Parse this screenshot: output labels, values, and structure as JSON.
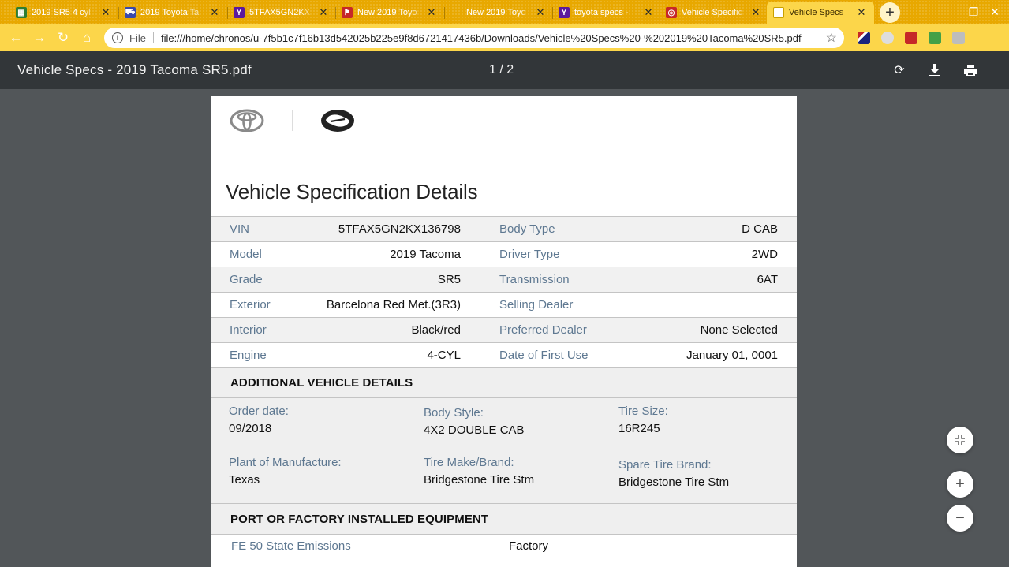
{
  "browser": {
    "tabs": [
      {
        "title": "2019 SR5 4 cyl",
        "favicon_color": "#2e7d32",
        "favicon_glyph": "▦",
        "icon": "image-favicon"
      },
      {
        "title": "2019 Toyota Ta",
        "favicon_color": "#3949ab",
        "favicon_glyph": "🚗",
        "icon": "car-favicon"
      },
      {
        "title": "5TFAX5GN2KX",
        "favicon_color": "#5c1a9e",
        "favicon_glyph": "Y",
        "icon": "yahoo-favicon"
      },
      {
        "title": "New 2019 Toyo",
        "favicon_color": "#c62828",
        "favicon_glyph": "⚑",
        "icon": "dealer-favicon"
      },
      {
        "title": "New 2019 Toyo",
        "favicon_color": "",
        "favicon_glyph": "",
        "icon": "blank-favicon"
      },
      {
        "title": "toyota specs -",
        "favicon_color": "#5c1a9e",
        "favicon_glyph": "Y",
        "icon": "yahoo-favicon"
      },
      {
        "title": "Vehicle Specific",
        "favicon_color": "#c62828",
        "favicon_glyph": "T",
        "icon": "toyota-favicon"
      },
      {
        "title": "Vehicle Specs",
        "favicon_color": "#ffffff",
        "favicon_glyph": "",
        "icon": "document-favicon"
      }
    ],
    "active_tab_index": 7,
    "url_scheme": "File",
    "url": "file:///home/chronos/u-7f5b1c7f16b13d542025b225e9f8d6721417436b/Downloads/Vehicle%20Specs%20-%202019%20Tacoma%20SR5.pdf",
    "theme_color": "#fcd64a"
  },
  "viewer": {
    "title": "Vehicle Specs - 2019 Tacoma SR5.pdf",
    "page_indicator": "1 / 2"
  },
  "document": {
    "heading": "Vehicle Specification Details",
    "specs": [
      {
        "l_label": "VIN",
        "l_value": "5TFAX5GN2KX136798",
        "r_label": "Body Type",
        "r_value": "D CAB"
      },
      {
        "l_label": "Model",
        "l_value": "2019 Tacoma",
        "r_label": "Driver Type",
        "r_value": "2WD"
      },
      {
        "l_label": "Grade",
        "l_value": "SR5",
        "r_label": "Transmission",
        "r_value": "6AT"
      },
      {
        "l_label": "Exterior",
        "l_value": "Barcelona Red Met.(3R3)",
        "r_label": "Selling Dealer",
        "r_value": ""
      },
      {
        "l_label": "Interior",
        "l_value": "Black/red",
        "r_label": "Preferred Dealer",
        "r_value": "None Selected"
      },
      {
        "l_label": "Engine",
        "l_value": "4-CYL",
        "r_label": "Date of First Use",
        "r_value": "January 01, 0001"
      }
    ],
    "additional": {
      "heading": "ADDITIONAL VEHICLE DETAILS",
      "items": [
        {
          "label": "Order date:",
          "value": "09/2018"
        },
        {
          "label": "Body Style:",
          "value": "4X2 DOUBLE CAB"
        },
        {
          "label": "Tire Size:",
          "value": "16R245"
        },
        {
          "label": "Plant of Manufacture:",
          "value": "Texas"
        },
        {
          "label": "Tire Make/Brand:",
          "value": "Bridgestone Tire Stm"
        },
        {
          "label": "Spare Tire Brand:",
          "value": "Bridgestone Tire Stm"
        }
      ]
    },
    "equipment": {
      "heading": "PORT OR FACTORY INSTALLED EQUIPMENT",
      "items": [
        {
          "label": "FE 50 State Emissions",
          "value": "Factory"
        }
      ]
    }
  }
}
